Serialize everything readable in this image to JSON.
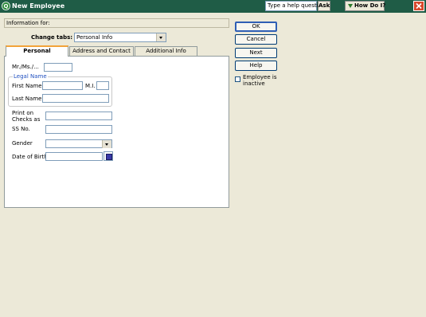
{
  "window": {
    "title": "New Employee"
  },
  "help": {
    "question_text": "Type a help question",
    "ask_label": "Ask",
    "how_do_i_label": "How Do I?"
  },
  "info": {
    "label": "Information for:"
  },
  "change_tabs": {
    "label": "Change tabs:",
    "value": "Personal Info"
  },
  "tabs": [
    {
      "label": "Personal",
      "active": true
    },
    {
      "label": "Address and Contact",
      "active": false
    },
    {
      "label": "Additional Info",
      "active": false
    }
  ],
  "form": {
    "salutation_label": "Mr./Ms./...",
    "legal_name_label": "Legal Name",
    "first_name_label": "First Name",
    "mi_label": "M.I.",
    "last_name_label": "Last Name",
    "print_on_checks_label_1": "Print on",
    "print_on_checks_label_2": "Checks as",
    "ssn_label": "SS No.",
    "gender_label": "Gender",
    "dob_label": "Date of Birth"
  },
  "buttons": {
    "ok": "OK",
    "cancel": "Cancel",
    "next": "Next",
    "help": "Help"
  },
  "inactive": {
    "label": "Employee is inactive",
    "checked": false
  },
  "colors": {
    "titlebar": "#1f5c46",
    "tab_accent": "#f2a33a",
    "legal_name_title": "#2050c0"
  }
}
